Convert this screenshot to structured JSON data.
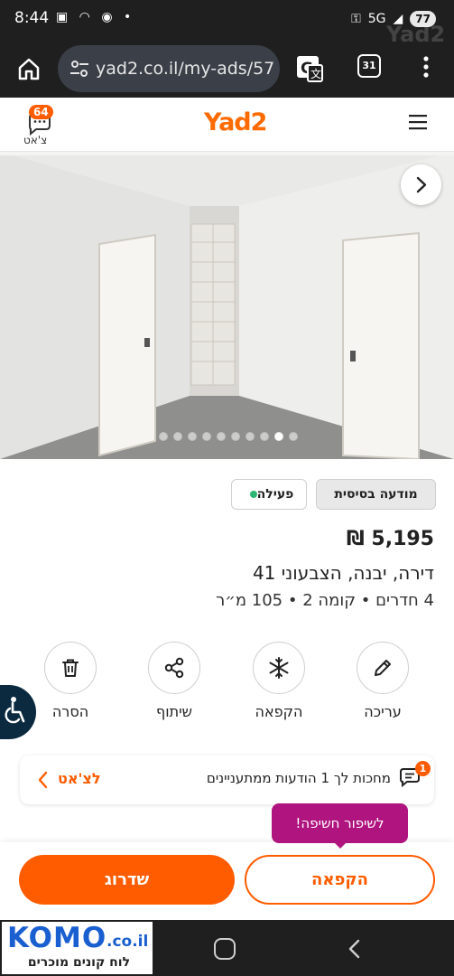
{
  "status_bar": {
    "time": "8:44",
    "network": "5G",
    "battery": "77"
  },
  "browser": {
    "url": "yad2.co.il/my-ads/57",
    "tabs_count": "31"
  },
  "app_header": {
    "logo": "Yad2",
    "chat_label": "צ'אט",
    "chat_count": "64"
  },
  "gallery": {
    "dot_count": 10,
    "active_index": 8
  },
  "ad": {
    "ad_type": "מודעה בסיסית",
    "status": "פעילה",
    "price": "5,195 ₪",
    "address": "דירה, יבנה, הצבעוני 41",
    "details": "4 חדרים  •  קומה 2  •  105 מ״ר"
  },
  "actions": [
    {
      "label": "עריכה",
      "icon": "pencil-icon"
    },
    {
      "label": "הקפאה",
      "icon": "snowflake-icon"
    },
    {
      "label": "שיתוף",
      "icon": "share-icon"
    },
    {
      "label": "הסרה",
      "icon": "trash-icon"
    }
  ],
  "chat_notice": {
    "badge": "1",
    "message": "מחכות לך 1 הודעות ממתעניינים",
    "link": "לצ'אט"
  },
  "tooltip": "לשיפור חשיפה!",
  "buttons": {
    "freeze": "הקפאה",
    "upgrade": "שדרוג"
  },
  "komo": {
    "name": "KOMO",
    "domain": ".co.il",
    "tagline": "לוח קונים מוכרים"
  },
  "colors": {
    "brand": "#ff5c00",
    "tooltip": "#b0157f",
    "status_green": "#2bb673"
  }
}
